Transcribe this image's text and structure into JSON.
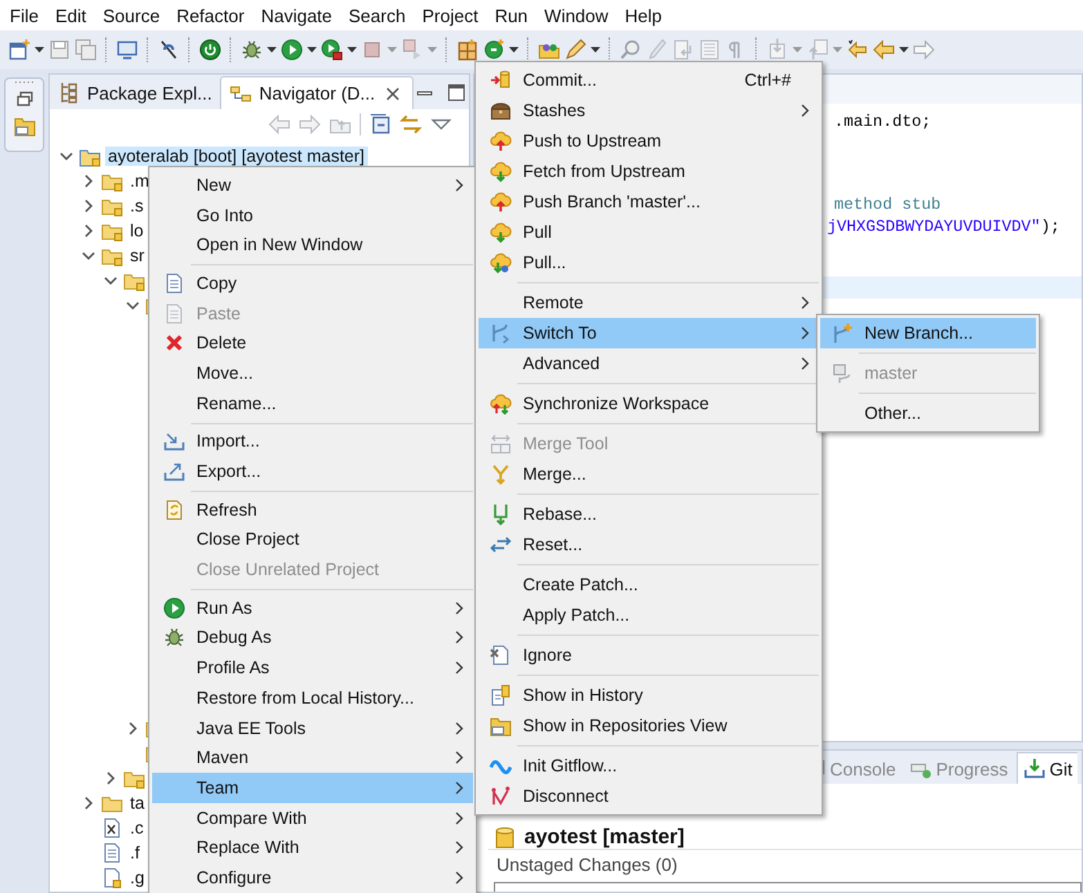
{
  "menu_bar": [
    "File",
    "Edit",
    "Source",
    "Refactor",
    "Navigate",
    "Search",
    "Project",
    "Run",
    "Window",
    "Help"
  ],
  "navigator": {
    "tabs": [
      {
        "label": "Package Expl...",
        "selected": false
      },
      {
        "label": "Navigator (D...",
        "selected": true
      }
    ],
    "tree": [
      {
        "label": "ayoteralab [boot] [ayotest master]",
        "kind": "project",
        "selected": true,
        "expanded": true,
        "children": [
          {
            "label": ".m",
            "kind": "folder",
            "selected": false,
            "expanded": false
          },
          {
            "label": ".s",
            "kind": "folder",
            "selected": false,
            "expanded": false
          },
          {
            "label": "lo",
            "kind": "folder",
            "selected": false,
            "expanded": false
          },
          {
            "label": "sr",
            "kind": "folder",
            "selected": false,
            "expanded": true,
            "children": [
              {
                "kind": "folder",
                "expanded": true,
                "children": [
                  {
                    "kind": "hidden",
                    "expanded": true
                  },
                  {
                    "kind": "hidden",
                    "expanded": false
                  },
                  {
                    "kind": "hidden"
                  }
                ]
              },
              {
                "kind": "folder",
                "expanded": false
              }
            ]
          },
          {
            "label": "ta",
            "kind": "plainfolder",
            "selected": false,
            "expanded": false
          },
          {
            "label": ".c",
            "kind": "xml",
            "selected": false
          },
          {
            "label": ".f",
            "kind": "file",
            "selected": false
          },
          {
            "label": ".g",
            "kind": "gitfile",
            "selected": false
          }
        ]
      }
    ]
  },
  "editor": {
    "lines": [
      {
        "segments": [
          {
            "text": ".main.dto;",
            "kind": "plain"
          }
        ]
      },
      {
        "segments": [
          {
            "text": "method stub",
            "kind": "comment"
          }
        ]
      },
      {
        "segments": [
          {
            "text": "jVHXGSDBWYDAYUVDUIVDV\"",
            "kind": "string"
          },
          {
            "text": ");",
            "kind": "plain"
          }
        ]
      }
    ]
  },
  "bottom_panel": {
    "tabs": [
      {
        "label": "Console",
        "selected": false
      },
      {
        "label": "Progress",
        "selected": false
      },
      {
        "label": "Git",
        "selected": true
      }
    ],
    "repository": "ayotest [master]",
    "section": "Unstaged Changes (0)"
  },
  "context_menu": {
    "items": [
      {
        "kind": "item",
        "label": "New",
        "submenu": true,
        "disabled": false,
        "selected": false
      },
      {
        "kind": "item",
        "label": "Go Into",
        "submenu": false,
        "disabled": false,
        "selected": false
      },
      {
        "kind": "item",
        "label": "Open in New Window",
        "submenu": false,
        "disabled": false,
        "selected": false
      },
      {
        "kind": "separator"
      },
      {
        "kind": "item",
        "label": "Copy",
        "submenu": false,
        "disabled": false,
        "selected": false
      },
      {
        "kind": "item",
        "label": "Paste",
        "submenu": false,
        "disabled": true,
        "selected": false
      },
      {
        "kind": "item",
        "label": "Delete",
        "submenu": false,
        "disabled": false,
        "selected": false
      },
      {
        "kind": "item",
        "label": "Move...",
        "submenu": false,
        "disabled": false,
        "selected": false
      },
      {
        "kind": "item",
        "label": "Rename...",
        "submenu": false,
        "disabled": false,
        "selected": false
      },
      {
        "kind": "separator"
      },
      {
        "kind": "item",
        "label": "Import...",
        "submenu": false,
        "disabled": false,
        "selected": false
      },
      {
        "kind": "item",
        "label": "Export...",
        "submenu": false,
        "disabled": false,
        "selected": false
      },
      {
        "kind": "separator"
      },
      {
        "kind": "item",
        "label": "Refresh",
        "submenu": false,
        "disabled": false,
        "selected": false
      },
      {
        "kind": "item",
        "label": "Close Project",
        "submenu": false,
        "disabled": false,
        "selected": false
      },
      {
        "kind": "item",
        "label": "Close Unrelated Project",
        "submenu": false,
        "disabled": true,
        "selected": false
      },
      {
        "kind": "separator"
      },
      {
        "kind": "item",
        "label": "Run As",
        "submenu": true,
        "disabled": false,
        "selected": false
      },
      {
        "kind": "item",
        "label": "Debug As",
        "submenu": true,
        "disabled": false,
        "selected": false
      },
      {
        "kind": "item",
        "label": "Profile As",
        "submenu": true,
        "disabled": false,
        "selected": false
      },
      {
        "kind": "item",
        "label": "Restore from Local History...",
        "submenu": false,
        "disabled": false,
        "selected": false
      },
      {
        "kind": "item",
        "label": "Java EE Tools",
        "submenu": true,
        "disabled": false,
        "selected": false
      },
      {
        "kind": "item",
        "label": "Maven",
        "submenu": true,
        "disabled": false,
        "selected": false
      },
      {
        "kind": "item",
        "label": "Team",
        "submenu": true,
        "disabled": false,
        "selected": true
      },
      {
        "kind": "item",
        "label": "Compare With",
        "submenu": true,
        "disabled": false,
        "selected": false
      },
      {
        "kind": "item",
        "label": "Replace With",
        "submenu": true,
        "disabled": false,
        "selected": false
      },
      {
        "kind": "item",
        "label": "Configure",
        "submenu": true,
        "disabled": false,
        "selected": false
      }
    ]
  },
  "team_menu": {
    "items": [
      {
        "kind": "item",
        "label": "Commit...",
        "shortcut": "Ctrl+#",
        "submenu": false,
        "disabled": false,
        "selected": false
      },
      {
        "kind": "item",
        "label": "Stashes",
        "submenu": true,
        "disabled": false,
        "selected": false
      },
      {
        "kind": "item",
        "label": "Push to Upstream",
        "submenu": false,
        "disabled": false,
        "selected": false
      },
      {
        "kind": "item",
        "label": "Fetch from Upstream",
        "submenu": false,
        "disabled": false,
        "selected": false
      },
      {
        "kind": "item",
        "label": "Push Branch 'master'...",
        "submenu": false,
        "disabled": false,
        "selected": false
      },
      {
        "kind": "item",
        "label": "Pull",
        "submenu": false,
        "disabled": false,
        "selected": false
      },
      {
        "kind": "item",
        "label": "Pull...",
        "submenu": false,
        "disabled": false,
        "selected": false
      },
      {
        "kind": "separator"
      },
      {
        "kind": "item",
        "label": "Remote",
        "submenu": true,
        "disabled": false,
        "selected": false
      },
      {
        "kind": "item",
        "label": "Switch To",
        "submenu": true,
        "disabled": false,
        "selected": true
      },
      {
        "kind": "item",
        "label": "Advanced",
        "submenu": true,
        "disabled": false,
        "selected": false
      },
      {
        "kind": "separator"
      },
      {
        "kind": "item",
        "label": "Synchronize Workspace",
        "submenu": false,
        "disabled": false,
        "selected": false
      },
      {
        "kind": "separator"
      },
      {
        "kind": "item",
        "label": "Merge Tool",
        "submenu": false,
        "disabled": true,
        "selected": false
      },
      {
        "kind": "item",
        "label": "Merge...",
        "submenu": false,
        "disabled": false,
        "selected": false
      },
      {
        "kind": "separator"
      },
      {
        "kind": "item",
        "label": "Rebase...",
        "submenu": false,
        "disabled": false,
        "selected": false
      },
      {
        "kind": "item",
        "label": "Reset...",
        "submenu": false,
        "disabled": false,
        "selected": false
      },
      {
        "kind": "separator"
      },
      {
        "kind": "item",
        "label": "Create Patch...",
        "submenu": false,
        "disabled": false,
        "selected": false
      },
      {
        "kind": "item",
        "label": "Apply Patch...",
        "submenu": false,
        "disabled": false,
        "selected": false
      },
      {
        "kind": "separator"
      },
      {
        "kind": "item",
        "label": "Ignore",
        "submenu": false,
        "disabled": false,
        "selected": false
      },
      {
        "kind": "separator"
      },
      {
        "kind": "item",
        "label": "Show in History",
        "submenu": false,
        "disabled": false,
        "selected": false
      },
      {
        "kind": "item",
        "label": "Show in Repositories View",
        "submenu": false,
        "disabled": false,
        "selected": false
      },
      {
        "kind": "separator"
      },
      {
        "kind": "item",
        "label": "Init Gitflow...",
        "submenu": false,
        "disabled": false,
        "selected": false
      },
      {
        "kind": "item",
        "label": "Disconnect",
        "submenu": false,
        "disabled": false,
        "selected": false
      }
    ]
  },
  "switch_menu": {
    "items": [
      {
        "kind": "item",
        "label": "New Branch...",
        "submenu": false,
        "disabled": false,
        "selected": true
      },
      {
        "kind": "separator"
      },
      {
        "kind": "item",
        "label": "master",
        "submenu": false,
        "disabled": true,
        "selected": false
      },
      {
        "kind": "separator"
      },
      {
        "kind": "item",
        "label": "Other...",
        "submenu": false,
        "disabled": false,
        "selected": false
      }
    ]
  }
}
